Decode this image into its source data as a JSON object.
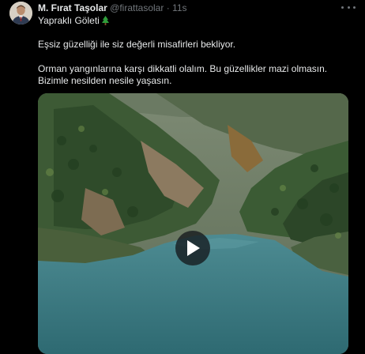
{
  "tweet": {
    "author": {
      "display_name": "M. Fırat Taşolar",
      "handle": "@firattasolar",
      "separator": "·",
      "timestamp": "11s"
    },
    "subtitle": "Yapraklı Göleti",
    "text_line_1": "Eşsiz güzelliği ile siz değerli misafirleri bekliyor.",
    "text_line_2": "Orman yangınlarına karşı dikkatli olalım. Bu güzellikler mazi olmasın.",
    "text_line_3": "Bizimle nesilden nesile yaşasın.",
    "media": {
      "type": "video",
      "play_icon": "play-icon"
    },
    "icons": {
      "more": "more-options-icon",
      "subtitle_emoji": "evergreen-tree-icon"
    }
  },
  "colors": {
    "background": "#000000",
    "text_primary": "#e7e9ea",
    "text_secondary": "#71767b",
    "lake": "#3f7f86"
  }
}
